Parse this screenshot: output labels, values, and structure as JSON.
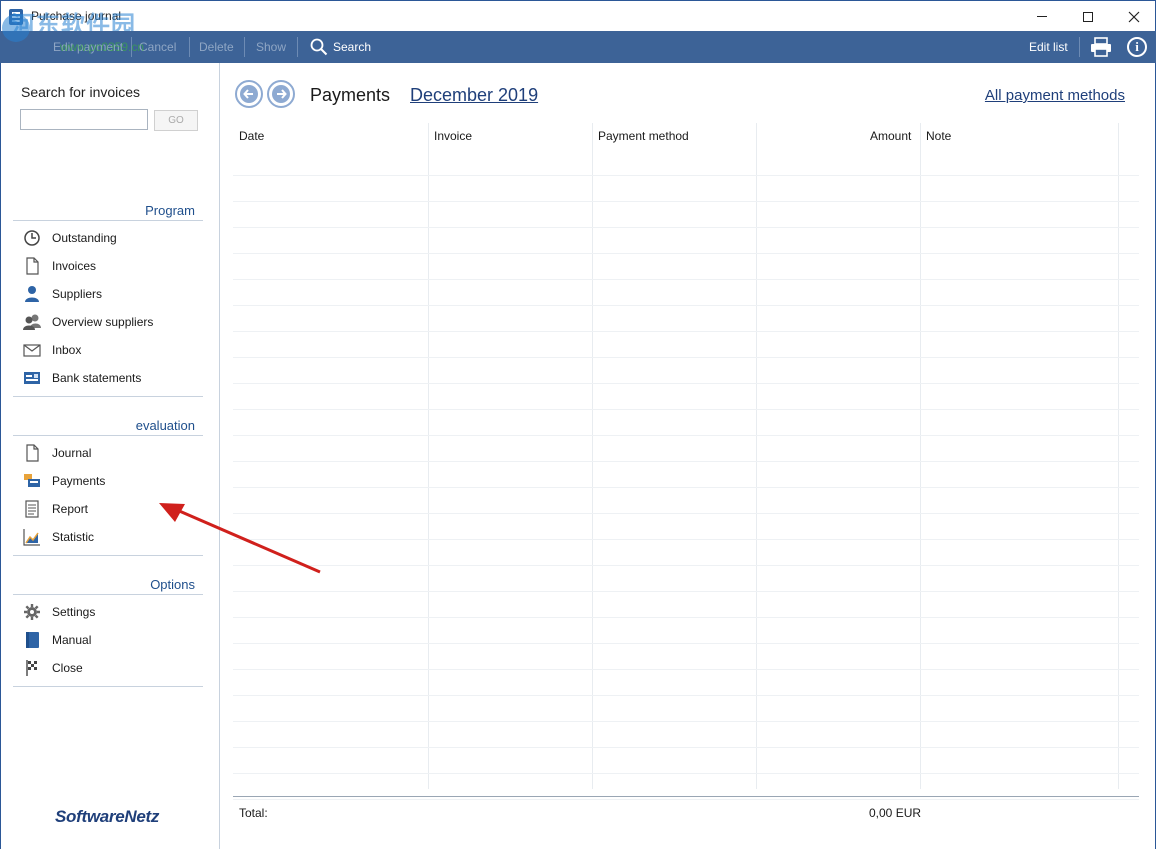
{
  "window": {
    "title": "Purchase journal",
    "watermark": "河东软件园",
    "watermark_url": "www.pc0359.cn"
  },
  "toolbar": {
    "edit_payment": "Edit payment",
    "cancel": "Cancel",
    "delete": "Delete",
    "show": "Show",
    "search": "Search",
    "edit_list": "Edit list"
  },
  "sidebar": {
    "search_label": "Search for invoices",
    "search_value": "",
    "go_label": "GO",
    "sections": {
      "program": {
        "title": "Program",
        "items": [
          "Outstanding",
          "Invoices",
          "Suppliers",
          "Overview suppliers",
          "Inbox",
          "Bank statements"
        ]
      },
      "evaluation": {
        "title": "evaluation",
        "items": [
          "Journal",
          "Payments",
          "Report",
          "Statistic"
        ]
      },
      "options": {
        "title": "Options",
        "items": [
          "Settings",
          "Manual",
          "Close"
        ]
      }
    },
    "brand": "SoftwareNetz"
  },
  "main": {
    "heading": "Payments",
    "period": "December 2019",
    "methods_link": "All payment methods",
    "columns": [
      "Date",
      "Invoice",
      "Payment method",
      "Amount",
      "Note"
    ],
    "rows": [],
    "total_label": "Total:",
    "total_value": "0,00 EUR"
  },
  "colors": {
    "toolbar_bg": "#3d6397",
    "accent": "#1f3f7a",
    "annotation_arrow": "#d0201c"
  }
}
